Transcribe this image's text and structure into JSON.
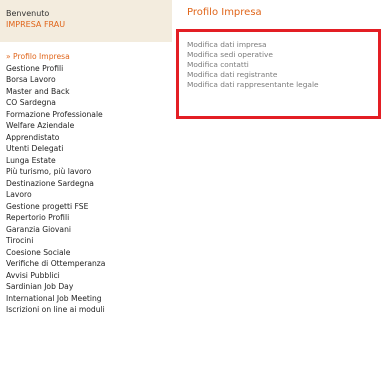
{
  "sidebar": {
    "welcome_label": "Benvenuto",
    "user_name": "IMPRESA FRAU",
    "items": [
      "» Profilo Impresa",
      "Gestione Profili",
      "Borsa Lavoro",
      "Master and Back",
      "CO Sardegna",
      "Formazione Professionale",
      "Welfare Aziendale",
      "Apprendistato",
      "Utenti Delegati",
      "Lunga Estate",
      "Più turismo, più lavoro",
      "Destinazione Sardegna",
      "Lavoro",
      "Gestione progetti FSE",
      "Repertorio Profili",
      "Garanzia Giovani",
      "Tirocini",
      "Coesione Sociale",
      "Verifiche di Ottemperanza",
      "Avvisi Pubblici",
      "Sardinian Job Day",
      "International Job Meeting",
      "Iscrizioni on line ai moduli"
    ]
  },
  "main": {
    "title": "Profilo Impresa",
    "actions": [
      "Modifica dati impresa",
      "Modifica sedi operative",
      "Modifica contatti",
      "Modifica dati registrante",
      "Modifica dati rappresentante legale"
    ]
  },
  "colors": {
    "accent": "#e0651a",
    "highlight_border": "#e31e24",
    "welcome_bg": "#f3ecde"
  }
}
